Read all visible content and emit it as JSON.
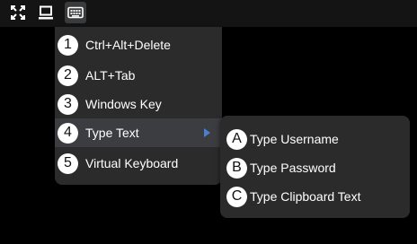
{
  "toolbar": {
    "buttons": [
      {
        "icon": "fullscreen-icon"
      },
      {
        "icon": "monitor-icon"
      },
      {
        "icon": "keyboard-icon",
        "active": true
      }
    ]
  },
  "keyboard_menu": {
    "items": [
      {
        "badge": "1",
        "label": "Ctrl+Alt+Delete"
      },
      {
        "badge": "2",
        "label": "ALT+Tab"
      },
      {
        "badge": "3",
        "label": "Windows Key"
      },
      {
        "badge": "4",
        "label": "Type Text",
        "highlighted": true,
        "has_submenu": true
      },
      {
        "badge": "5",
        "label": "Virtual Keyboard"
      }
    ]
  },
  "type_text_submenu": {
    "items": [
      {
        "badge": "A",
        "label": "Type Username"
      },
      {
        "badge": "B",
        "label": "Type Password"
      },
      {
        "badge": "C",
        "label": "Type Clipboard Text"
      }
    ]
  },
  "colors": {
    "background": "#000000",
    "toolbar": "#141414",
    "menu": "#2b2b2b",
    "highlight": "#3c3d40",
    "submenu_arrow": "#4a7fd3"
  }
}
